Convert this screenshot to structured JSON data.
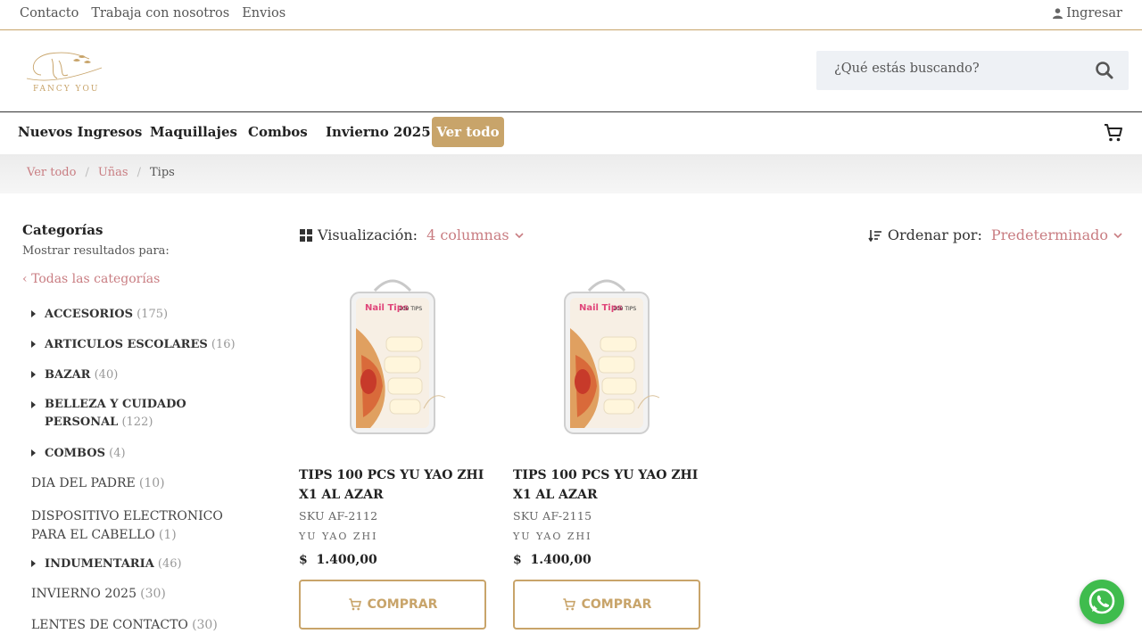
{
  "topbar": {
    "links": [
      "Contacto",
      "Trabaja con nosotros",
      "Envios"
    ],
    "login": "Ingresar"
  },
  "header": {
    "logo_text": "FANCY YOU",
    "search_placeholder": "¿Qué estás buscando?"
  },
  "nav": {
    "items": [
      "Nuevos Ingresos",
      "Maquillajes",
      "Combos",
      "Invierno 2025"
    ],
    "highlight": "Ver todo"
  },
  "breadcrumb": [
    "Ver todo",
    "Uñas",
    "Tips"
  ],
  "sidebar": {
    "title": "Categorías",
    "subtitle": "Mostrar resultados para:",
    "all": "Todas las categorías",
    "categories": [
      {
        "name": "ACCESORIOS",
        "count": "(175)"
      },
      {
        "name": "ARTICULOS ESCOLARES",
        "count": "(16)"
      },
      {
        "name": "BAZAR",
        "count": "(40)"
      },
      {
        "name": "BELLEZA Y CUIDADO PERSONAL",
        "count": "(122)"
      },
      {
        "name": "COMBOS",
        "count": "(4)"
      },
      {
        "name": "DIA DEL PADRE",
        "count": "(10)"
      },
      {
        "name": "DISPOSITIVO ELECTRONICO PARA EL CABELLO",
        "count": "(1)"
      },
      {
        "name": "INDUMENTARIA",
        "count": "(46)"
      },
      {
        "name": "INVIERNO 2025",
        "count": "(30)"
      },
      {
        "name": "LENTES DE CONTACTO",
        "count": "(30)"
      }
    ]
  },
  "toolbar": {
    "view_label": "Visualización:",
    "view_value": "4 columnas",
    "sort_label": "Ordenar por:",
    "sort_value": "Predeterminado"
  },
  "products": [
    {
      "title": "TIPS 100 PCS YU YAO ZHI X1 AL AZAR",
      "sku": "SKU AF-2112",
      "brand": "YU YAO ZHI",
      "currency": "$",
      "price": "1.400,00",
      "buy": "COMPRAR"
    },
    {
      "title": "TIPS 100 PCS YU YAO ZHI X1 AL AZAR",
      "sku": "SKU AF-2115",
      "brand": "YU YAO ZHI",
      "currency": "$",
      "price": "1.400,00",
      "buy": "COMPRAR"
    }
  ],
  "product_image_text": {
    "brand": "Nail Tips",
    "count": "100 TIPS"
  },
  "colors": {
    "accent": "#c8a46a",
    "link": "#c97d82",
    "whatsapp": "#3fbc4d"
  }
}
